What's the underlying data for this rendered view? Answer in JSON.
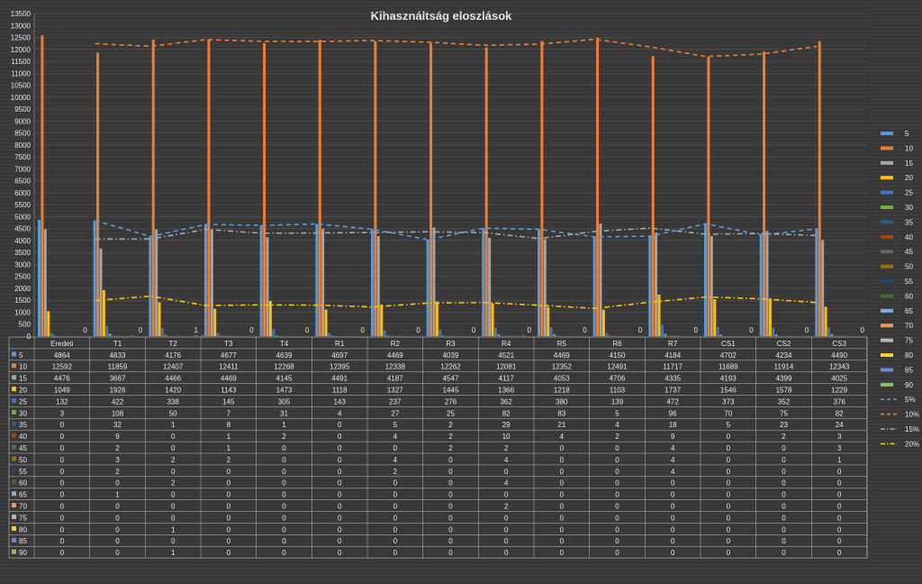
{
  "chart_data": {
    "type": "bar",
    "title": "Kihasználtság eloszlások",
    "xlabel": "",
    "ylabel": "",
    "ylim": [
      0,
      13500
    ],
    "ytick_step": 500,
    "grid": true,
    "legend_position": "right",
    "data_table": true,
    "categories": [
      "Eredeti",
      "T1",
      "T2",
      "T3",
      "T4",
      "R1",
      "R2",
      "R3",
      "R4",
      "R5",
      "R6",
      "R7",
      "CS1",
      "CS2",
      "CS3"
    ],
    "series": [
      {
        "name": "5",
        "color": "#5b9bd5",
        "values": [
          4864,
          4833,
          4176,
          4677,
          4639,
          4697,
          4469,
          4039,
          4521,
          4469,
          4150,
          4184,
          4702,
          4234,
          4490
        ]
      },
      {
        "name": "10",
        "color": "#ed7d31",
        "values": [
          12592,
          11859,
          12407,
          12411,
          12268,
          12395,
          12338,
          12262,
          12081,
          12352,
          12491,
          11717,
          11689,
          11914,
          12343
        ]
      },
      {
        "name": "15",
        "color": "#a5a5a5",
        "values": [
          4476,
          3667,
          4466,
          4469,
          4145,
          4491,
          4187,
          4547,
          4117,
          4053,
          4706,
          4335,
          4193,
          4399,
          4025
        ]
      },
      {
        "name": "20",
        "color": "#ffc000",
        "values": [
          1049,
          1926,
          1420,
          1143,
          1473,
          1118,
          1327,
          1445,
          1366,
          1218,
          1103,
          1737,
          1546,
          1578,
          1229
        ]
      },
      {
        "name": "25",
        "color": "#4472c4",
        "values": [
          132,
          422,
          338,
          145,
          305,
          143,
          237,
          276,
          362,
          380,
          139,
          472,
          373,
          352,
          376
        ]
      },
      {
        "name": "30",
        "color": "#70ad47",
        "values": [
          3,
          108,
          50,
          7,
          31,
          4,
          27,
          25,
          82,
          83,
          5,
          96,
          70,
          75,
          82
        ]
      },
      {
        "name": "35",
        "color": "#255e91",
        "values": [
          0,
          32,
          1,
          8,
          1,
          0,
          5,
          2,
          29,
          21,
          4,
          18,
          5,
          23,
          24
        ]
      },
      {
        "name": "40",
        "color": "#9e480e",
        "values": [
          0,
          9,
          0,
          1,
          2,
          0,
          4,
          2,
          10,
          4,
          2,
          9,
          0,
          2,
          3
        ]
      },
      {
        "name": "45",
        "color": "#636363",
        "values": [
          0,
          2,
          0,
          1,
          0,
          0,
          0,
          2,
          2,
          0,
          0,
          4,
          0,
          0,
          3
        ]
      },
      {
        "name": "50",
        "color": "#997300",
        "values": [
          0,
          3,
          2,
          2,
          0,
          0,
          4,
          0,
          4,
          0,
          0,
          4,
          0,
          0,
          1
        ]
      },
      {
        "name": "55",
        "color": "#264478",
        "values": [
          0,
          2,
          0,
          0,
          0,
          0,
          2,
          0,
          0,
          0,
          0,
          4,
          0,
          0,
          0
        ]
      },
      {
        "name": "60",
        "color": "#43682b",
        "values": [
          0,
          0,
          2,
          0,
          0,
          0,
          0,
          0,
          4,
          0,
          0,
          0,
          0,
          0,
          0
        ]
      },
      {
        "name": "65",
        "color": "#7cafdd",
        "values": [
          0,
          1,
          0,
          0,
          0,
          0,
          0,
          0,
          0,
          0,
          0,
          0,
          0,
          0,
          0
        ]
      },
      {
        "name": "70",
        "color": "#f1975a",
        "values": [
          0,
          0,
          0,
          0,
          0,
          0,
          0,
          0,
          2,
          0,
          0,
          0,
          0,
          0,
          0
        ]
      },
      {
        "name": "75",
        "color": "#b7b7b7",
        "values": [
          0,
          0,
          0,
          0,
          0,
          0,
          0,
          0,
          0,
          0,
          0,
          0,
          0,
          0,
          0
        ]
      },
      {
        "name": "80",
        "color": "#ffcd33",
        "values": [
          0,
          0,
          1,
          0,
          0,
          0,
          0,
          0,
          0,
          0,
          0,
          0,
          0,
          0,
          0
        ]
      },
      {
        "name": "85",
        "color": "#698ed0",
        "values": [
          0,
          0,
          0,
          0,
          0,
          0,
          0,
          0,
          0,
          0,
          0,
          0,
          0,
          0,
          0
        ]
      },
      {
        "name": "90",
        "color": "#8cc168",
        "values": [
          0,
          0,
          1,
          0,
          0,
          0,
          0,
          0,
          0,
          0,
          0,
          0,
          0,
          0,
          0
        ]
      }
    ],
    "bar_labels": [
      "0",
      "0",
      "1",
      "0",
      "0",
      "0",
      "0",
      "0",
      "0",
      "0",
      "0",
      "0",
      "0",
      "0",
      "0"
    ],
    "trendlines": [
      {
        "name": "5%",
        "color": "#5b9bd5",
        "dash": "dash",
        "values": [
          4833,
          4176,
          4677,
          4639,
          4697,
          4469,
          4039,
          4521,
          4469,
          4150,
          4184,
          4702,
          4234,
          4490
        ]
      },
      {
        "name": "10%",
        "color": "#ed7d31",
        "dash": "dash",
        "values": [
          12240,
          12133,
          12409,
          12340,
          12332,
          12367,
          12300,
          12172,
          12217,
          12422,
          12104,
          11703,
          11802,
          12129
        ]
      },
      {
        "name": "15%",
        "color": "#a5a5a5",
        "dash": "dashdot",
        "values": [
          4066,
          4067,
          4468,
          4307,
          4318,
          4339,
          4367,
          4332,
          4085,
          4380,
          4521,
          4264,
          4296,
          4212
        ]
      },
      {
        "name": "20%",
        "color": "#ffc000",
        "dash": "dashdot",
        "values": [
          1488,
          1673,
          1282,
          1308,
          1296,
          1223,
          1386,
          1406,
          1292,
          1161,
          1420,
          1642,
          1562,
          1404
        ]
      }
    ]
  }
}
